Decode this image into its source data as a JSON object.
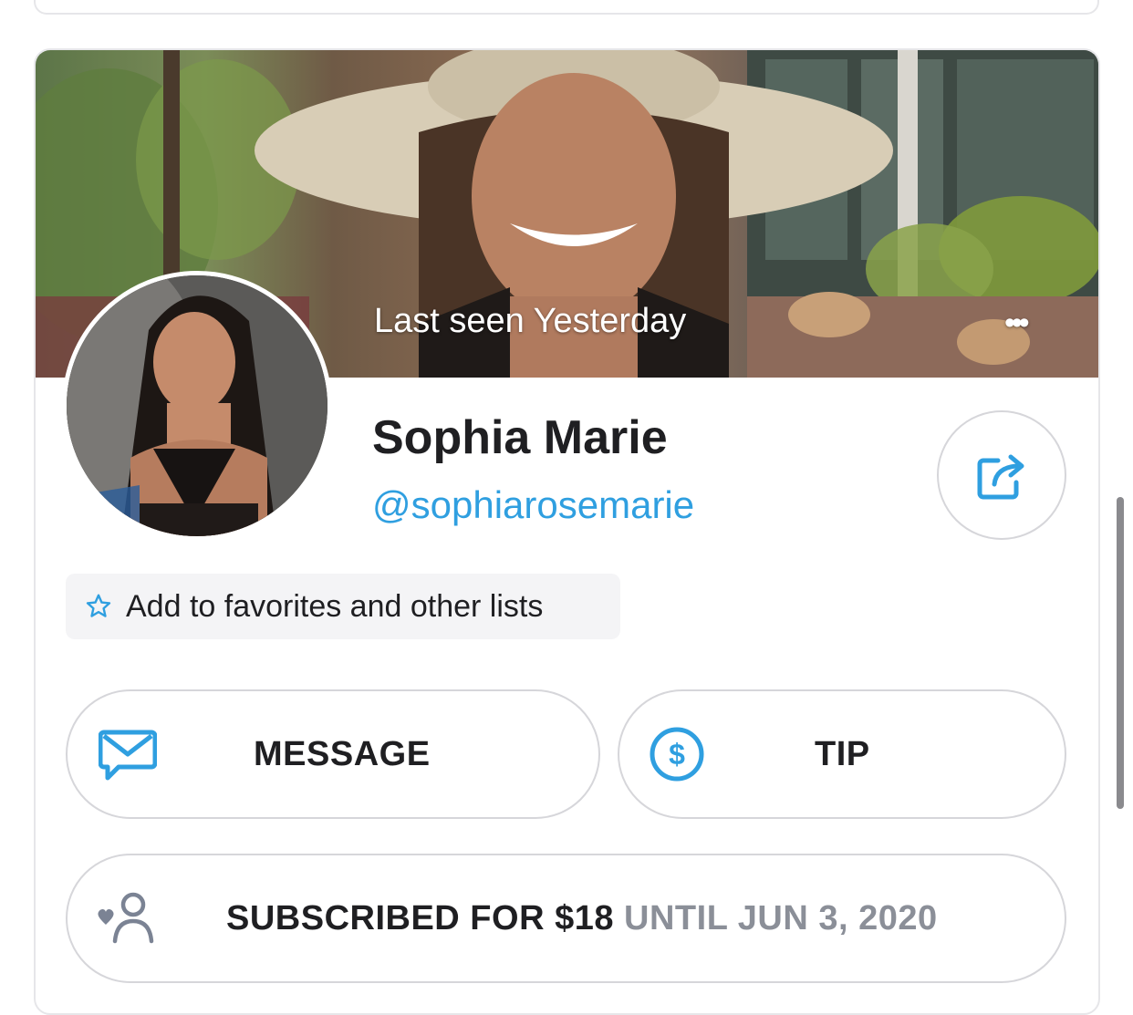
{
  "profile": {
    "last_seen": "Last seen Yesterday",
    "more_label": "•••",
    "name": "Sophia Marie",
    "handle": "@sophiarosemarie"
  },
  "favorites": {
    "label": "Add to favorites and other lists"
  },
  "actions": {
    "message_label": "MESSAGE",
    "tip_label": "TIP",
    "subscribed_label": "SUBSCRIBED FOR $18",
    "subscribed_until": "UNTIL JUN 3, 2020"
  },
  "colors": {
    "accent": "#2f9fe0",
    "text": "#1f1f22",
    "muted": "#8b8f98",
    "border": "#d6d6da"
  },
  "icons": {
    "star": "star-icon",
    "share": "share-icon",
    "message": "envelope-icon",
    "tip": "dollar-circle-icon",
    "subscribe": "user-heart-icon",
    "more": "more-dots-icon"
  }
}
